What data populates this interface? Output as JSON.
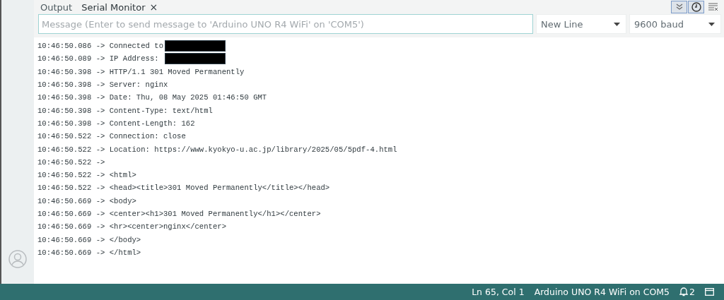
{
  "tabs": [
    {
      "label": "Output",
      "selected": false,
      "closable": false
    },
    {
      "label": "Serial Monitor",
      "selected": true,
      "closable": true,
      "close": "×"
    }
  ],
  "toolbar": [
    {
      "kind": "autoscroll",
      "on": true
    },
    {
      "kind": "timestamp",
      "on": true
    },
    {
      "kind": "clear",
      "on": false
    }
  ],
  "message": {
    "placeholder": "Message (Enter to send message to 'Arduino UNO R4 WiFi' on 'COM5')"
  },
  "line_ending": {
    "value": "New Line"
  },
  "baud": {
    "value": "9600 baud"
  },
  "log": [
    {
      "text": "10:46:50.086 -> Connected to",
      "redacted": true
    },
    {
      "text": "10:46:50.089 -> IP Address: ",
      "redacted": true
    },
    {
      "text": "10:46:50.398 -> HTTP/1.1 301 Moved Permanently",
      "redacted": false
    },
    {
      "text": "10:46:50.398 -> Server: nginx",
      "redacted": false
    },
    {
      "text": "10:46:50.398 -> Date: Thu, 08 May 2025 01:46:50 GMT",
      "redacted": false
    },
    {
      "text": "10:46:50.398 -> Content-Type: text/html",
      "redacted": false
    },
    {
      "text": "10:46:50.398 -> Content-Length: 162",
      "redacted": false
    },
    {
      "text": "10:46:50.522 -> Connection: close",
      "redacted": false
    },
    {
      "text": "10:46:50.522 -> Location: https://www.kyokyo-u.ac.jp/library/2025/05/5pdf-4.html",
      "redacted": false
    },
    {
      "text": "10:46:50.522 ->",
      "redacted": false
    },
    {
      "text": "10:46:50.522 -> <html>",
      "redacted": false
    },
    {
      "text": "10:46:50.522 -> <head><title>301 Moved Permanently</title></head>",
      "redacted": false
    },
    {
      "text": "10:46:50.669 -> <body>",
      "redacted": false
    },
    {
      "text": "10:46:50.669 -> <center><h1>301 Moved Permanently</h1></center>",
      "redacted": false
    },
    {
      "text": "10:46:50.669 -> <hr><center>nginx</center>",
      "redacted": false
    },
    {
      "text": "10:46:50.669 -> </body>",
      "redacted": false
    },
    {
      "text": "10:46:50.669 -> </html>",
      "redacted": false
    }
  ],
  "status_bar": {
    "position": "Ln 65, Col 1",
    "board": "Arduino UNO R4 WiFi on COM5",
    "notifications": "2"
  }
}
